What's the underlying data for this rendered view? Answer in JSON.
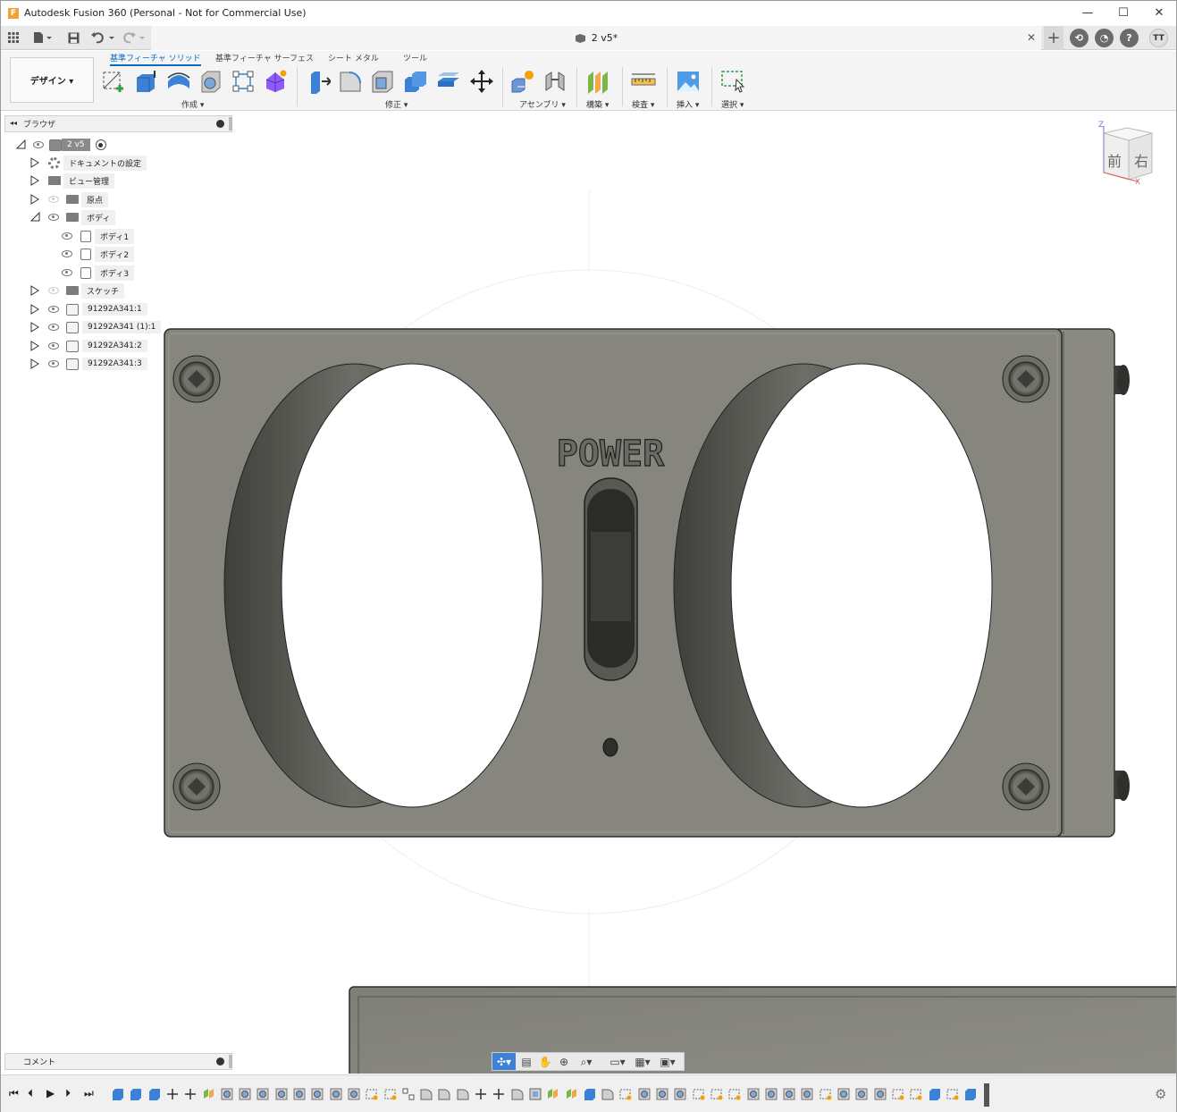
{
  "window": {
    "title": "Autodesk Fusion 360 (Personal - Not for Commercial Use)",
    "app_icon_letter": "F",
    "minimize": "—",
    "maximize": "☐",
    "close": "✕"
  },
  "tabbar": {
    "doc_tab_label": "2 v5*",
    "close_tab": "✕",
    "new_tab": "+",
    "user_initials": "TT",
    "help": "?"
  },
  "ribbon": {
    "workspace": "デザイン ▾",
    "tabs": [
      "基準フィーチャ ソリッド",
      "基準フィーチャ サーフェス",
      "シート メタル",
      "ツール"
    ],
    "groups": [
      "作成 ▾",
      "修正 ▾",
      "アセンブリ ▾",
      "構築 ▾",
      "検査 ▾",
      "挿入 ▾",
      "選択 ▾"
    ]
  },
  "browser": {
    "title": "ブラウザ",
    "root": "2 v5",
    "items": [
      {
        "label": "ドキュメントの設定",
        "icon": "gear-icon"
      },
      {
        "label": "ビュー管理",
        "icon": "folder-icon"
      },
      {
        "label": "原点",
        "icon": "folder-icon"
      },
      {
        "label": "ボディ",
        "icon": "folder-icon"
      },
      {
        "label": "ボディ1",
        "icon": "body-icon"
      },
      {
        "label": "ボディ2",
        "icon": "body-icon"
      },
      {
        "label": "ボディ3",
        "icon": "body-icon"
      },
      {
        "label": "スケッチ",
        "icon": "folder-icon"
      },
      {
        "label": "91292A341:1",
        "icon": "component-icon"
      },
      {
        "label": "91292A341 (1):1",
        "icon": "component-icon"
      },
      {
        "label": "91292A341:2",
        "icon": "component-icon"
      },
      {
        "label": "91292A341:3",
        "icon": "component-icon"
      }
    ]
  },
  "viewcube": {
    "front": "前",
    "right": "右",
    "z_axis": "Z",
    "x_axis": "X"
  },
  "model": {
    "engraved_text": "POWER"
  },
  "comments": {
    "title": "コメント"
  },
  "colors": {
    "part_gray": "#86867e",
    "part_dark": "#4f4f4a",
    "accent_blue": "#0b6bc7",
    "timeline_feature": "#3b82d6"
  }
}
